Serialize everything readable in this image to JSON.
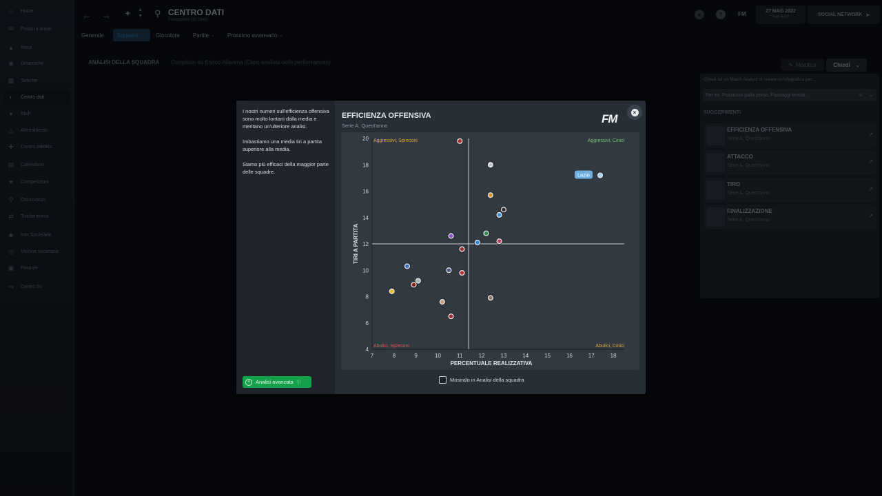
{
  "sidebar": {
    "items": [
      {
        "label": "Home",
        "icon": "home-icon"
      },
      {
        "label": "Posta in arrivo",
        "icon": "inbox-icon"
      },
      {
        "label": "Rosa",
        "icon": "shirt-icon"
      },
      {
        "label": "Dinamiche",
        "icon": "people-icon"
      },
      {
        "label": "Tattiche",
        "icon": "tactics-icon"
      },
      {
        "label": "Centro dati",
        "icon": "data-icon"
      },
      {
        "label": "Staff",
        "icon": "staff-icon"
      },
      {
        "label": "Allenamento",
        "icon": "training-icon"
      },
      {
        "label": "Centro medico",
        "icon": "medical-icon"
      },
      {
        "label": "Calendario",
        "icon": "calendar-icon"
      },
      {
        "label": "Competizioni",
        "icon": "trophy-icon"
      },
      {
        "label": "Osservatori",
        "icon": "scout-icon"
      },
      {
        "label": "Trasferimenti",
        "icon": "transfer-icon"
      },
      {
        "label": "Info Societarie",
        "icon": "shield-icon"
      },
      {
        "label": "Visione societaria",
        "icon": "vision-icon"
      },
      {
        "label": "Finanze",
        "icon": "finance-icon"
      },
      {
        "label": "Centro Sv.",
        "icon": "development-icon"
      }
    ],
    "active_index": 5
  },
  "header": {
    "title": "CENTRO DATI",
    "subtitle": "Prestazione (ID 1949)",
    "tabs": [
      "Generale",
      "Squadra",
      "Giocatore",
      "Partite",
      "Prossimo avversario"
    ],
    "active_tab": 1,
    "fm_label": "FM",
    "help_label": "?",
    "date": "27 MAG 2022",
    "time": "Ven 8:00",
    "social": "SOCIAL NETWORK"
  },
  "section": {
    "title": "ANALISI DELLA SQUADRA",
    "subtitle": "Compilato da Enrico Allavena (Capo analista delle performances)",
    "edit_label": "Modifica",
    "ask_label": "Chiedi"
  },
  "right_panel": {
    "description": "Chiedi ad un Match Analyst di creare un'infografica per...",
    "placeholder": "Per es. Possesso palla perso, Passaggi tentati...",
    "suggestions_title": "SUGGERIMENTI",
    "suggestions": [
      {
        "title": "EFFICIENZA OFFENSIVA",
        "subtitle": "Serie A, Quest'anno"
      },
      {
        "title": "ATTACCO",
        "subtitle": "Serie A, Quest'anno"
      },
      {
        "title": "TIRO",
        "subtitle": "Serie A, Quest'anno"
      },
      {
        "title": "FINALIZZAZIONE",
        "subtitle": "Serie A, Quest'anno"
      }
    ]
  },
  "modal": {
    "paragraphs": [
      "I nostri numeri sull'efficienza offensiva sono molto lontani dalla media e meritano un'ulteriore analisi.",
      "Imbastiamo una media tiri a partita superiore alla media.",
      "Siamo più efficaci della maggior parte delle squadre."
    ],
    "advanced_label": "Analisi avanzata",
    "show_label": "Mostralo in Analisi della squadra",
    "logo": "FM",
    "close": "×"
  },
  "chart_data": {
    "type": "scatter",
    "title": "EFFICIENZA OFFENSIVA",
    "subtitle": "Serie A, Quest'anno",
    "xlabel": "PERCENTUALE REALIZZATIVA",
    "ylabel": "TIRI A PARTITA",
    "xlim": [
      7,
      18.5
    ],
    "ylim": [
      4,
      20
    ],
    "xticks": [
      7,
      8,
      9,
      10,
      11,
      12,
      13,
      14,
      15,
      16,
      17,
      18
    ],
    "yticks": [
      4,
      6,
      8,
      10,
      12,
      14,
      16,
      18,
      20
    ],
    "avg_x": 11.4,
    "avg_y": 12,
    "quadrants": {
      "top_left": "Aggressivi, Spreconi",
      "top_right": "Aggressivi, Cinici",
      "bottom_left": "Abulici, Spreconi",
      "bottom_right": "Abulici, Cinici"
    },
    "quadrant_colors": {
      "top_left": "#e0a640",
      "top_right": "#6fc36f",
      "bottom_left": "#e05050",
      "bottom_right": "#e0a640"
    },
    "highlight_label": "Lazio",
    "highlight_color": "#6eaee0",
    "points": [
      {
        "x": 11.0,
        "y": 19.8,
        "color": "#b02a30"
      },
      {
        "x": 12.4,
        "y": 18.0,
        "color": "#c9c9c9"
      },
      {
        "x": 17.4,
        "y": 17.2,
        "color": "#9fd0f0",
        "highlight": true
      },
      {
        "x": 12.4,
        "y": 15.7,
        "color": "#d09020"
      },
      {
        "x": 13.0,
        "y": 14.6,
        "color": "#303030"
      },
      {
        "x": 12.8,
        "y": 14.2,
        "color": "#4a90d8"
      },
      {
        "x": 12.2,
        "y": 12.8,
        "color": "#2e8b4a"
      },
      {
        "x": 10.6,
        "y": 12.6,
        "color": "#8a4fc8"
      },
      {
        "x": 11.8,
        "y": 12.1,
        "color": "#2f8fe0"
      },
      {
        "x": 12.8,
        "y": 12.2,
        "color": "#c04060"
      },
      {
        "x": 11.1,
        "y": 11.6,
        "color": "#a03030"
      },
      {
        "x": 8.6,
        "y": 10.3,
        "color": "#3070c0"
      },
      {
        "x": 10.5,
        "y": 10.0,
        "color": "#4a5a80"
      },
      {
        "x": 11.1,
        "y": 9.8,
        "color": "#c03030"
      },
      {
        "x": 9.1,
        "y": 9.2,
        "color": "#b0b0b0"
      },
      {
        "x": 8.9,
        "y": 8.9,
        "color": "#902020"
      },
      {
        "x": 7.9,
        "y": 8.4,
        "color": "#e8c020"
      },
      {
        "x": 12.4,
        "y": 7.9,
        "color": "#8a8070"
      },
      {
        "x": 10.2,
        "y": 7.6,
        "color": "#c8a080"
      },
      {
        "x": 10.6,
        "y": 6.5,
        "color": "#a02828"
      }
    ]
  }
}
